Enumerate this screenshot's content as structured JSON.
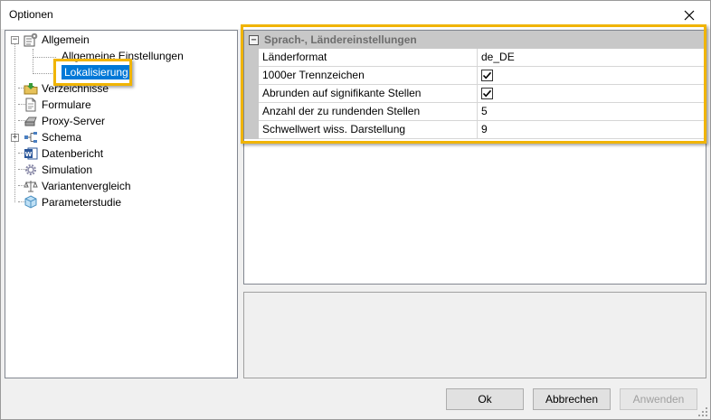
{
  "window": {
    "title": "Optionen"
  },
  "tree": {
    "items": [
      {
        "label": "Allgemein",
        "icon": "settings-checklist-icon",
        "expander": "−"
      },
      {
        "label": "Allgemeine Einstellungen"
      },
      {
        "label": "Lokalisierung"
      },
      {
        "label": "Verzeichnisse",
        "icon": "folder-icon"
      },
      {
        "label": "Formulare",
        "icon": "form-icon"
      },
      {
        "label": "Proxy-Server",
        "icon": "server-icon"
      },
      {
        "label": "Schema",
        "icon": "schema-icon",
        "expander": "+"
      },
      {
        "label": "Datenbericht",
        "icon": "word-document-icon"
      },
      {
        "label": "Simulation",
        "icon": "gear-icon"
      },
      {
        "label": "Variantenvergleich",
        "icon": "scale-icon"
      },
      {
        "label": "Parameterstudie",
        "icon": "cube-icon"
      }
    ]
  },
  "grid": {
    "category": {
      "label": "Sprach-, Ländereinstellungen",
      "expander": "−"
    },
    "properties": [
      {
        "name": "Länderformat",
        "value": "de_DE"
      },
      {
        "name": "1000er Trennzeichen",
        "checked": true
      },
      {
        "name": "Abrunden auf signifikante Stellen",
        "checked": true
      },
      {
        "name": "Anzahl der zu rundenden Stellen",
        "value": "5"
      },
      {
        "name": "Schwellwert wiss. Darstellung",
        "value": "9"
      }
    ]
  },
  "buttons": {
    "ok": "Ok",
    "cancel": "Abbrechen",
    "apply": "Anwenden"
  },
  "colors": {
    "highlight": "#f0b400",
    "selection": "#0078d7",
    "category_bg": "#c8c8c8"
  }
}
